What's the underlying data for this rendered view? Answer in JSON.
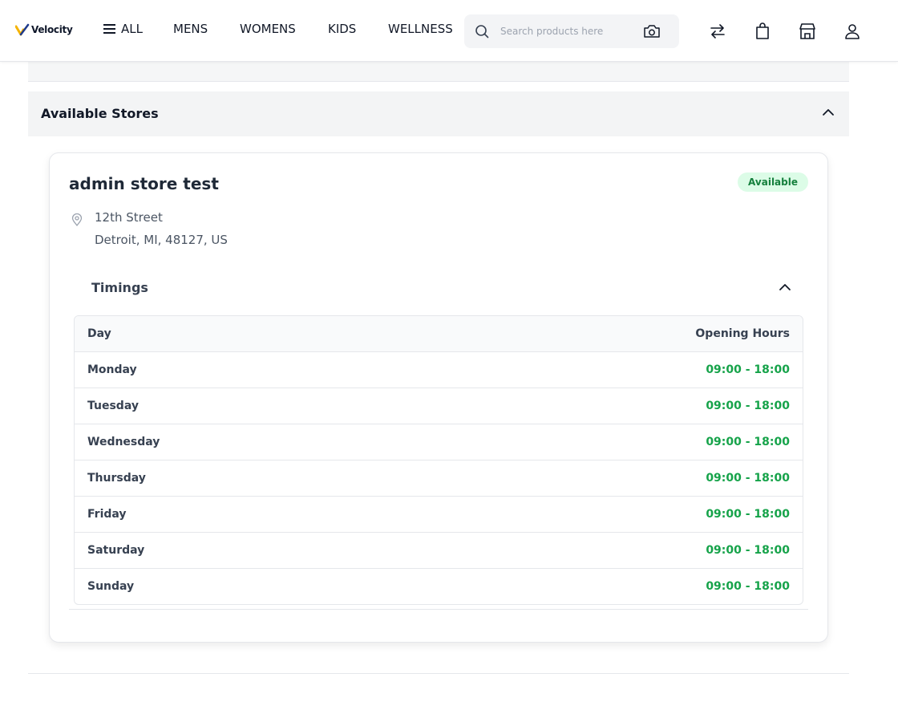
{
  "header": {
    "logo_text": "Velocity",
    "nav": [
      "ALL",
      "MENS",
      "WOMENS",
      "KIDS",
      "WELLNESS"
    ],
    "search_placeholder": "Search products here",
    "icons": [
      "search-icon",
      "camera-icon",
      "compare-icon",
      "bag-icon",
      "store-icon",
      "user-icon"
    ]
  },
  "section": {
    "title": "Available Stores"
  },
  "store": {
    "name": "admin store test",
    "status": "Available",
    "address_line1": "12th Street",
    "address_line2": "Detroit, MI, 48127, US",
    "timings_label": "Timings",
    "table": {
      "headers": [
        "Day",
        "Opening Hours"
      ],
      "rows": [
        {
          "day": "Monday",
          "hours": "09:00 - 18:00"
        },
        {
          "day": "Tuesday",
          "hours": "09:00 - 18:00"
        },
        {
          "day": "Wednesday",
          "hours": "09:00 - 18:00"
        },
        {
          "day": "Thursday",
          "hours": "09:00 - 18:00"
        },
        {
          "day": "Friday",
          "hours": "09:00 - 18:00"
        },
        {
          "day": "Saturday",
          "hours": "09:00 - 18:00"
        },
        {
          "day": "Sunday",
          "hours": "09:00 - 18:00"
        }
      ]
    }
  },
  "colors": {
    "accent_green": "#16a34a",
    "badge_bg": "#dcfce7",
    "logo_yellow": "#f5b301"
  }
}
